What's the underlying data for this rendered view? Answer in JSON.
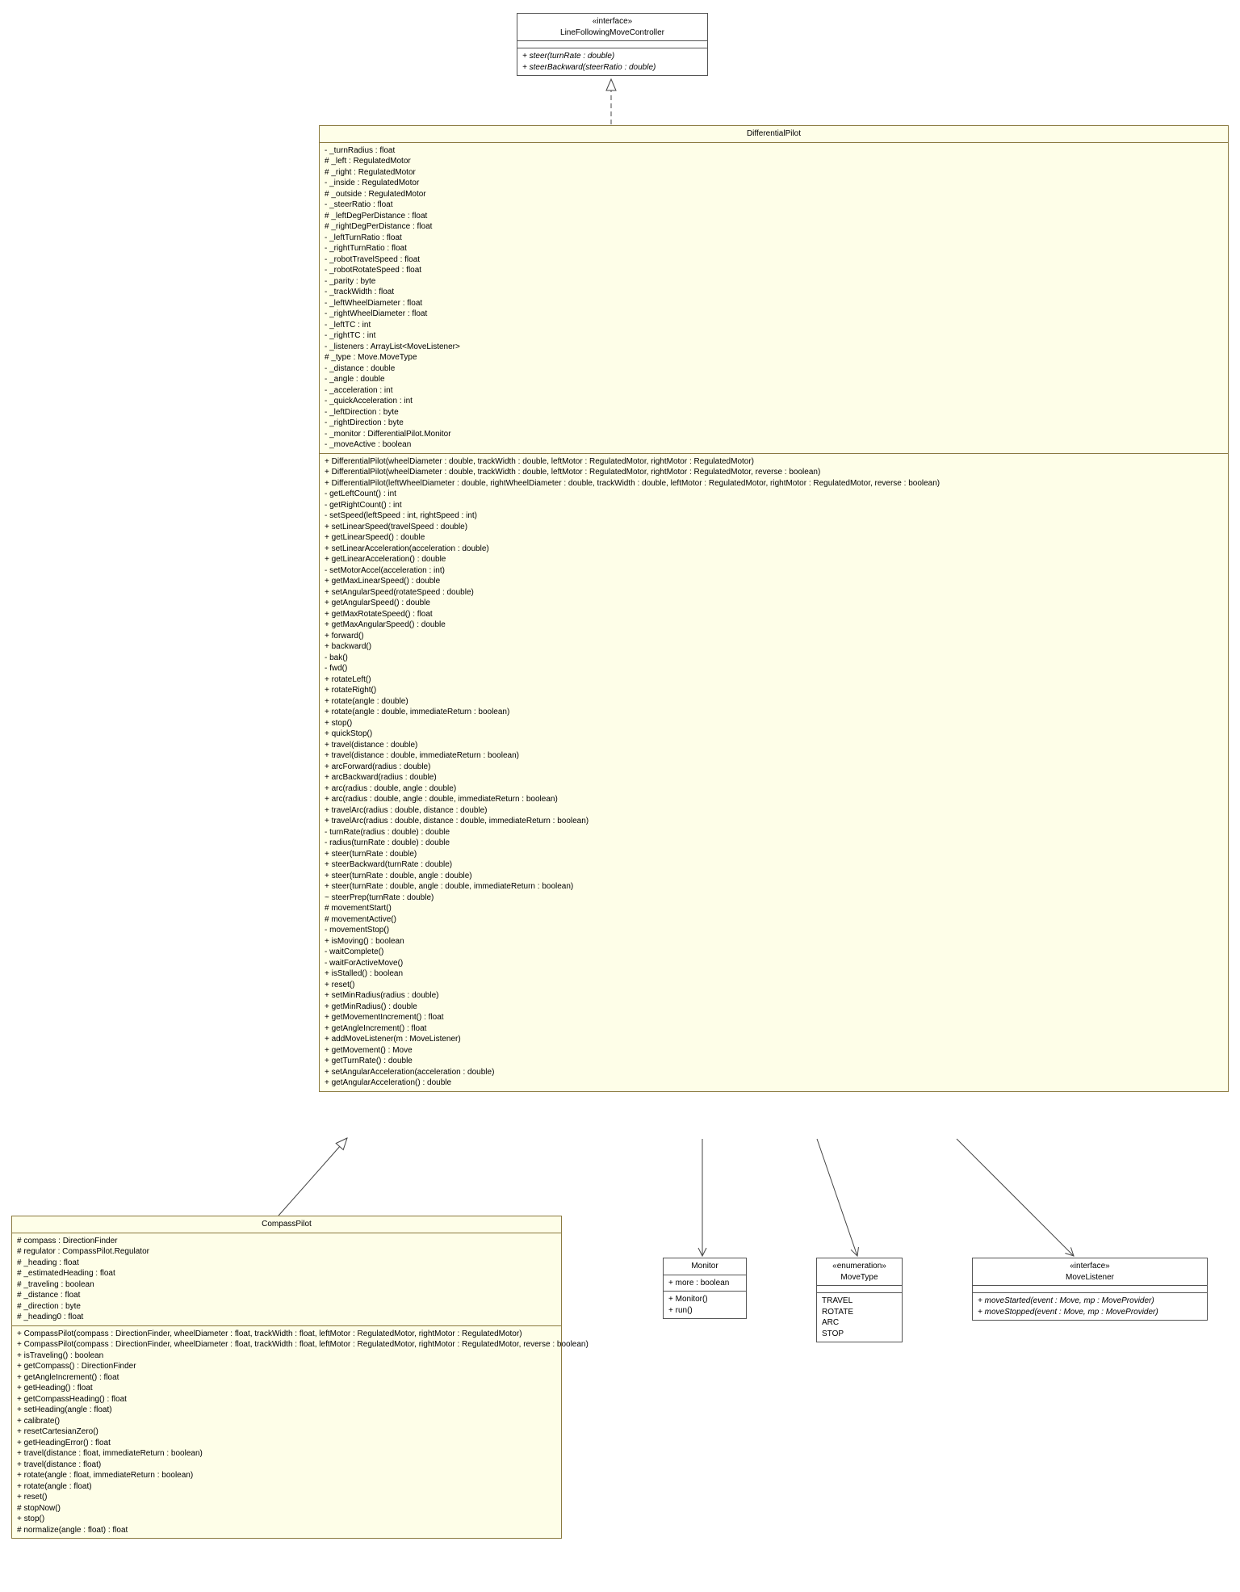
{
  "interfaceLFMC": {
    "stereo": "«interface»",
    "name": "LineFollowingMoveController",
    "ops": [
      "+ steer(turnRate : double)",
      "+ steerBackward(steerRatio : double)"
    ]
  },
  "differentialPilot": {
    "name": "DifferentialPilot",
    "attrs": [
      "- _turnRadius : float",
      "# _left : RegulatedMotor",
      "# _right : RegulatedMotor",
      "- _inside : RegulatedMotor",
      "# _outside : RegulatedMotor",
      "- _steerRatio : float",
      "# _leftDegPerDistance : float",
      "# _rightDegPerDistance : float",
      "- _leftTurnRatio : float",
      "- _rightTurnRatio : float",
      "- _robotTravelSpeed : float",
      "- _robotRotateSpeed : float",
      "- _parity : byte",
      "- _trackWidth : float",
      "- _leftWheelDiameter : float",
      "- _rightWheelDiameter : float",
      "- _leftTC : int",
      "- _rightTC : int",
      "- _listeners : ArrayList<MoveListener>",
      "# _type : Move.MoveType",
      "- _distance : double",
      "- _angle : double",
      "- _acceleration : int",
      "- _quickAcceleration : int",
      "- _leftDirection : byte",
      "- _rightDirection : byte",
      "- _monitor : DifferentialPilot.Monitor",
      "- _moveActive : boolean"
    ],
    "ops": [
      "+ DifferentialPilot(wheelDiameter : double, trackWidth : double, leftMotor : RegulatedMotor, rightMotor : RegulatedMotor)",
      "+ DifferentialPilot(wheelDiameter : double, trackWidth : double, leftMotor : RegulatedMotor, rightMotor : RegulatedMotor, reverse : boolean)",
      "+ DifferentialPilot(leftWheelDiameter : double, rightWheelDiameter : double, trackWidth : double, leftMotor : RegulatedMotor, rightMotor : RegulatedMotor, reverse : boolean)",
      "- getLeftCount() : int",
      "- getRightCount() : int",
      "- setSpeed(leftSpeed : int, rightSpeed : int)",
      "+ setLinearSpeed(travelSpeed : double)",
      "+ getLinearSpeed() : double",
      "+ setLinearAcceleration(acceleration : double)",
      "+ getLinearAcceleration() : double",
      "- setMotorAccel(acceleration : int)",
      "+ getMaxLinearSpeed() : double",
      "+ setAngularSpeed(rotateSpeed : double)",
      "+ getAngularSpeed() : double",
      "+ getMaxRotateSpeed() : float",
      "+ getMaxAngularSpeed() : double",
      "+ forward()",
      "+ backward()",
      "- bak()",
      "- fwd()",
      "+ rotateLeft()",
      "+ rotateRight()",
      "+ rotate(angle : double)",
      "+ rotate(angle : double, immediateReturn : boolean)",
      "+ stop()",
      "+ quickStop()",
      "+ travel(distance : double)",
      "+ travel(distance : double, immediateReturn : boolean)",
      "+ arcForward(radius : double)",
      "+ arcBackward(radius : double)",
      "+ arc(radius : double, angle : double)",
      "+ arc(radius : double, angle : double, immediateReturn : boolean)",
      "+ travelArc(radius : double, distance : double)",
      "+ travelArc(radius : double, distance : double, immediateReturn : boolean)",
      "- turnRate(radius : double) : double",
      "- radius(turnRate : double) : double",
      "+ steer(turnRate : double)",
      "+ steerBackward(turnRate : double)",
      "+ steer(turnRate : double, angle : double)",
      "+ steer(turnRate : double, angle : double, immediateReturn : boolean)",
      "~ steerPrep(turnRate : double)",
      "# movementStart()",
      "# movementActive()",
      "- movementStop()",
      "+ isMoving() : boolean",
      "- waitComplete()",
      "- waitForActiveMove()",
      "+ isStalled() : boolean",
      "+ reset()",
      "+ setMinRadius(radius : double)",
      "+ getMinRadius() : double",
      "+ getMovementIncrement() : float",
      "+ getAngleIncrement() : float",
      "+ addMoveListener(m : MoveListener)",
      "+ getMovement() : Move",
      "+ getTurnRate() : double",
      "+ setAngularAcceleration(acceleration : double)",
      "+ getAngularAcceleration() : double"
    ]
  },
  "compassPilot": {
    "name": "CompassPilot",
    "attrs": [
      "# compass : DirectionFinder",
      "# regulator : CompassPilot.Regulator",
      "# _heading : float",
      "# _estimatedHeading : float",
      "# _traveling : boolean",
      "# _distance : float",
      "# _direction : byte",
      "# _heading0 : float"
    ],
    "ops": [
      "+ CompassPilot(compass : DirectionFinder, wheelDiameter : float, trackWidth : float, leftMotor : RegulatedMotor, rightMotor : RegulatedMotor)",
      "+ CompassPilot(compass : DirectionFinder, wheelDiameter : float, trackWidth : float, leftMotor : RegulatedMotor, rightMotor : RegulatedMotor, reverse : boolean)",
      "+ isTraveling() : boolean",
      "+ getCompass() : DirectionFinder",
      "+ getAngleIncrement() : float",
      "+ getHeading() : float",
      "+ getCompassHeading() : float",
      "+ setHeading(angle : float)",
      "+ calibrate()",
      "+ resetCartesianZero()",
      "+ getHeadingError() : float",
      "+ travel(distance : float, immediateReturn : boolean)",
      "+ travel(distance : float)",
      "+ rotate(angle : float, immediateReturn : boolean)",
      "+ rotate(angle : float)",
      "+ reset()",
      "# stopNow()",
      "+ stop()",
      "# normalize(angle : float) : float"
    ]
  },
  "monitor": {
    "name": "Monitor",
    "attrs": [
      "+ more : boolean"
    ],
    "ops": [
      "+ Monitor()",
      "+ run()"
    ]
  },
  "moveType": {
    "stereo": "«enumeration»",
    "name": "MoveType",
    "vals": [
      "TRAVEL",
      "ROTATE",
      "ARC",
      "STOP"
    ]
  },
  "moveListener": {
    "stereo": "«interface»",
    "name": "MoveListener",
    "ops": [
      "+ moveStarted(event : Move, mp : MoveProvider)",
      "+ moveStopped(event : Move, mp : MoveProvider)"
    ]
  }
}
